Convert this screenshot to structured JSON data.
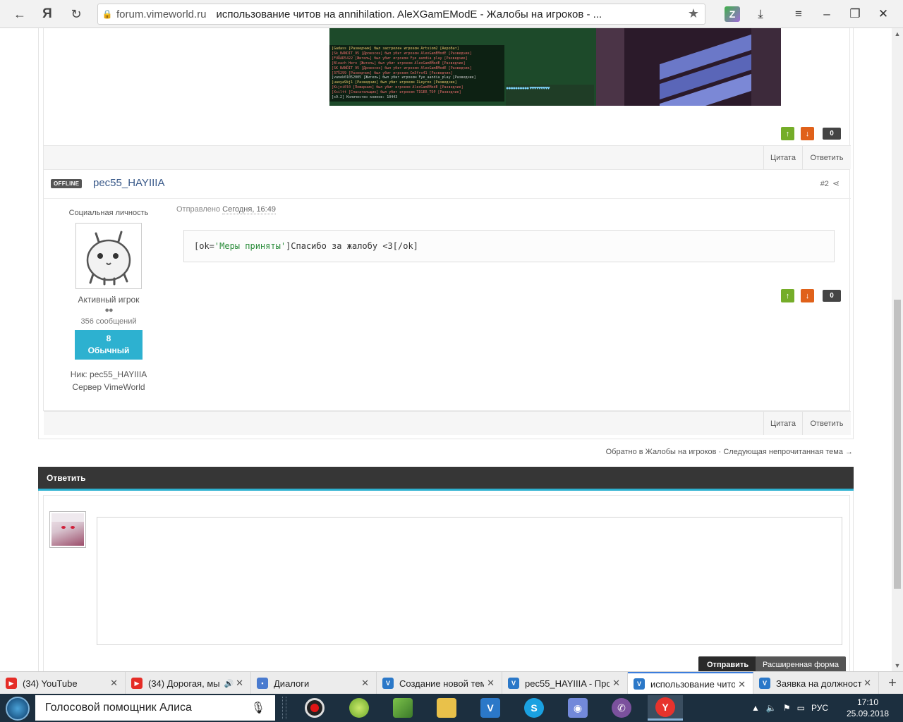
{
  "browser": {
    "url_host": "forum.vimeworld.ru",
    "page_title": "использование читов на annihilation. AleXGamEModE - Жалобы на игроков - ...",
    "ext_letter": "Z"
  },
  "post1": {
    "chat_lines": [
      "[Gadass [Разведчик] был застрелен игроком Artsiom2 [Акробат]",
      "[Sk_BANDIT_95 [Дровосек] был убит игроком AlexGamEModE [Разведчик]",
      "[FURAR5422 [Житель] был убит игроком Fye_aandia_play [Разведчик]",
      "[Bleach_Hero [Житель] был убит игроком AlexGamEModE [Разведчик]",
      "[SK_BANDIT_95 [Дровосек] был убит игроком AlexGamEModE [Разведчик]",
      "[375299 [Разведчик] был убит игроком Cm3fro41 [Разведчик]",
      "[vanek01052005 [Житель] был убит игроком Fye_aandia_play [Разведчик]",
      "[uaoya9kj1 [Разведчик] был убит игроком ILeyrox [Разведчик]",
      "[Kijni0l0 [Пожарник] был убит игроком AlexGamEModE [Разведчик]",
      "[Xsiltt [Спасательщик] был убит игроком TIGER_TOP [Разведчик]",
      "[x9.2] Количество коинов: 10443"
    ],
    "votes": "0",
    "quote": "Цитата",
    "reply": "Ответить"
  },
  "post2": {
    "status": "OFFLINE",
    "author": "pec55_HAYIIIA",
    "number": "#2",
    "user_title": "Социальная личность",
    "rank": "Активный игрок",
    "rank_dots": "●●",
    "message_count": "356 сообщений",
    "rep_value": "8",
    "rep_label": "Обычный",
    "nick": "Ник: pec55_HAYIIIA",
    "server": "Сервер VimeWorld",
    "sent_prefix": "Отправлено",
    "sent_date": "Сегодня, 16:49",
    "body_open": "[ok=",
    "body_attr": "'Меры приняты'",
    "body_rest": "]Спасибо за жалобу <3[/ok]",
    "votes": "0",
    "quote": "Цитата",
    "reply": "Ответить"
  },
  "nav": {
    "back": "Обратно в Жалобы на игроков",
    "separator": " · ",
    "next": "Следующая непрочитанная тема →"
  },
  "reply_form": {
    "header": "Ответить",
    "send": "Отправить",
    "extended": "Расширенная форма"
  },
  "tabs": [
    {
      "label": "(34) YouTube",
      "icon": "youtube-icon"
    },
    {
      "label": "(34) Дорогая, мы",
      "icon": "youtube-icon"
    },
    {
      "label": "Диалоги",
      "icon": "dialogs-icon"
    },
    {
      "label": "Создание новой тем",
      "icon": "vimeworld-icon"
    },
    {
      "label": "pec55_HAYIIIA - Про",
      "icon": "vimeworld-icon"
    },
    {
      "label": "использование чито",
      "icon": "vimeworld-icon"
    },
    {
      "label": "Заявка на должност",
      "icon": "vimeworld-icon"
    }
  ],
  "taskbar": {
    "alice": "Голосовой помощник Алиса",
    "lang": "РУС",
    "time": "17:10",
    "date": "25.09.2018"
  }
}
